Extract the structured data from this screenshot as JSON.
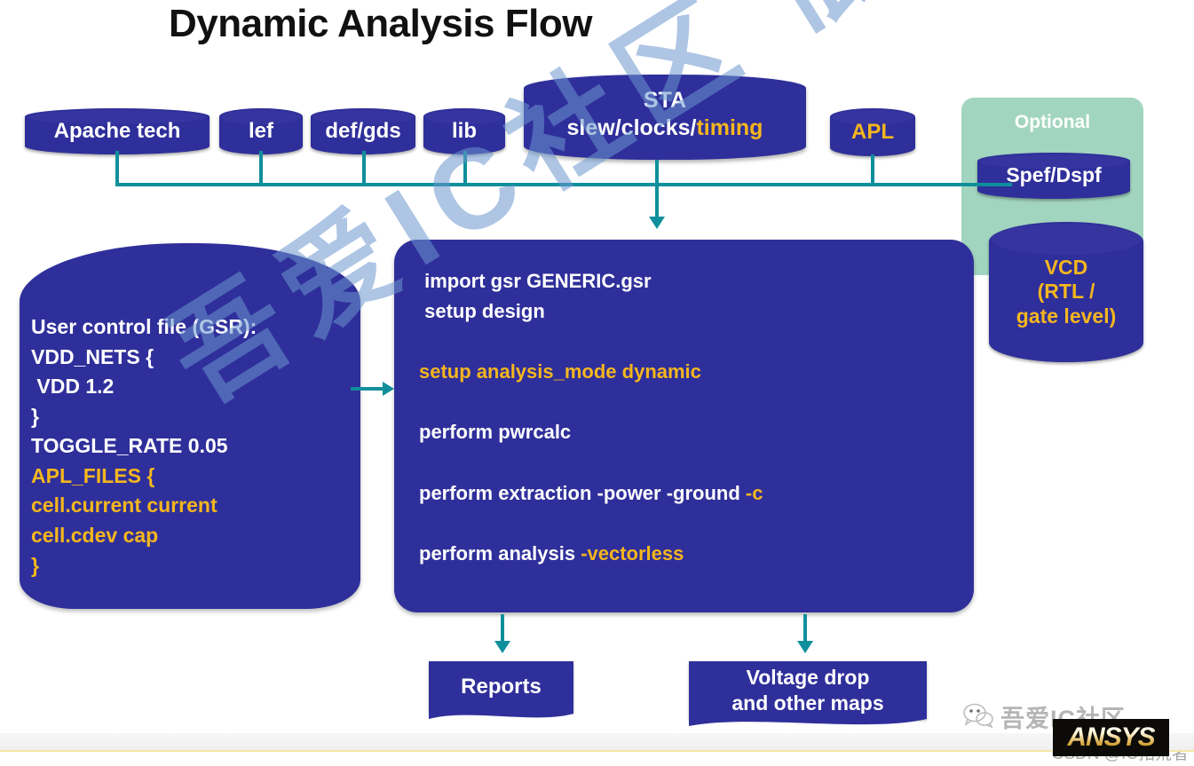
{
  "title": "Dynamic Analysis Flow",
  "inputs": [
    {
      "label": "Apache tech",
      "color": "#ffffff"
    },
    {
      "label": "lef",
      "color": "#ffffff"
    },
    {
      "label": "def/gds",
      "color": "#ffffff"
    },
    {
      "label": "lib",
      "color": "#ffffff"
    }
  ],
  "sta": {
    "line1": "STA",
    "line2_white": "slew/clocks/",
    "line2_gold": "timing"
  },
  "apl": {
    "label": "APL"
  },
  "optional": {
    "label": "Optional",
    "spef": "Spef/Dspf",
    "vcd_lines": [
      "VCD",
      "(RTL /",
      "gate level)"
    ]
  },
  "gsr": {
    "lines": [
      {
        "text": "User control file (GSR):",
        "color": "white"
      },
      {
        "text": "VDD_NETS {",
        "color": "white"
      },
      {
        "text": " VDD 1.2",
        "color": "white"
      },
      {
        "text": "}",
        "color": "white"
      },
      {
        "text": "TOGGLE_RATE 0.05",
        "color": "white"
      },
      {
        "text": "APL_FILES {",
        "color": "gold"
      },
      {
        "text": "cell.current current",
        "color": "gold"
      },
      {
        "text": "cell.cdev cap",
        "color": "gold"
      },
      {
        "text": "}",
        "color": "gold"
      }
    ]
  },
  "commands": {
    "lines": [
      {
        "segments": [
          {
            "t": " import gsr GENERIC.gsr",
            "c": "white"
          }
        ]
      },
      {
        "segments": [
          {
            "t": " setup design",
            "c": "white"
          }
        ]
      },
      {
        "segments": [
          {
            "t": "",
            "c": "white"
          }
        ]
      },
      {
        "segments": [
          {
            "t": "setup analysis_mode dynamic",
            "c": "gold"
          }
        ]
      },
      {
        "segments": [
          {
            "t": "",
            "c": "white"
          }
        ]
      },
      {
        "segments": [
          {
            "t": "perform pwrcalc",
            "c": "white"
          }
        ]
      },
      {
        "segments": [
          {
            "t": "",
            "c": "white"
          }
        ]
      },
      {
        "segments": [
          {
            "t": "perform extraction -power -ground ",
            "c": "white"
          },
          {
            "t": "-c",
            "c": "gold"
          }
        ]
      },
      {
        "segments": [
          {
            "t": "",
            "c": "white"
          }
        ]
      },
      {
        "segments": [
          {
            "t": "perform analysis ",
            "c": "white"
          },
          {
            "t": "-vectorless",
            "c": "gold"
          }
        ]
      }
    ]
  },
  "outputs": {
    "reports": "Reports",
    "maps_line1": "Voltage drop",
    "maps_line2": "and other maps"
  },
  "watermarks": {
    "diagonal": "吾爱IC社区 低功耗设计",
    "csdn": "CSDN @IC拓荒者",
    "brand": "吾爱IC社区",
    "ansys": "ANSYS"
  },
  "colors": {
    "box_blue": "#2f2f9b",
    "accent_gold": "#f4b61e",
    "connector_teal": "#0f8f9c",
    "optional_green": "#a2d5bf",
    "text_white": "#ffffff",
    "title_black": "#111111"
  }
}
